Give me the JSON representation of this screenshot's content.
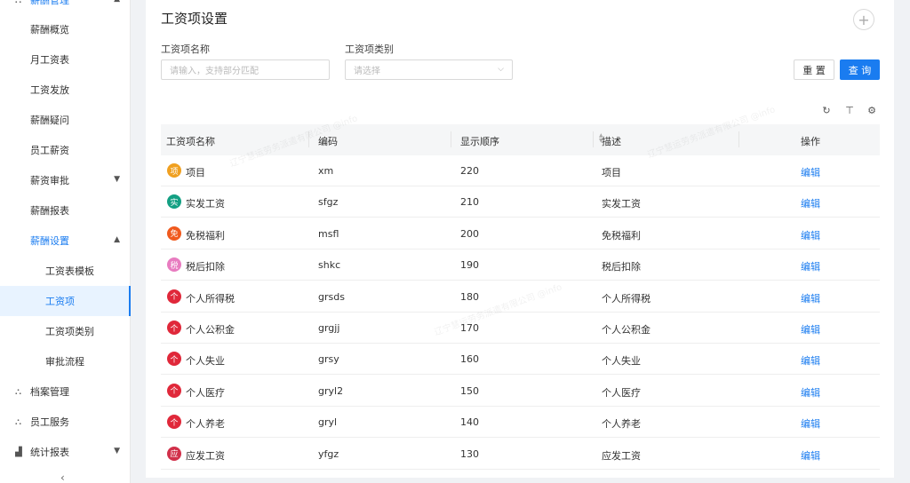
{
  "sidebar": {
    "header_label": "薪酬管理",
    "items": [
      {
        "label": "薪酬概览"
      },
      {
        "label": "月工资表"
      },
      {
        "label": "工资发放"
      },
      {
        "label": "薪酬疑问"
      },
      {
        "label": "员工薪资"
      },
      {
        "label": "薪资审批"
      },
      {
        "label": "薪酬报表"
      },
      {
        "label": "薪酬设置"
      },
      {
        "label": "工资表模板"
      },
      {
        "label": "工资项"
      },
      {
        "label": "工资项类别"
      },
      {
        "label": "审批流程"
      },
      {
        "label": "档案管理"
      },
      {
        "label": "员工服务"
      },
      {
        "label": "统计报表"
      }
    ]
  },
  "main": {
    "title": "工资项设置",
    "filters": {
      "name_label": "工资项名称",
      "name_placeholder": "请输入，支持部分匹配",
      "type_label": "工资项类别",
      "type_placeholder": "请选择"
    },
    "reset_label": "重 置",
    "query_label": "查 询",
    "table": {
      "columns": [
        "工资项名称",
        "编码",
        "显示顺序",
        "描述",
        "操作"
      ],
      "rows": [
        {
          "badge": "项",
          "color": "#f0a020",
          "name": "项目",
          "code": "xm",
          "order": "220",
          "desc": "项目",
          "op": "编辑"
        },
        {
          "badge": "实",
          "color": "#14a083",
          "name": "实发工资",
          "code": "sfgz",
          "order": "210",
          "desc": "实发工资",
          "op": "编辑"
        },
        {
          "badge": "免",
          "color": "#f05a1e",
          "name": "免税福利",
          "code": "msfl",
          "order": "200",
          "desc": "免税福利",
          "op": "编辑"
        },
        {
          "badge": "税",
          "color": "#e87cc0",
          "name": "税后扣除",
          "code": "shkc",
          "order": "190",
          "desc": "税后扣除",
          "op": "编辑"
        },
        {
          "badge": "个",
          "color": "#e0283a",
          "name": "个人所得税",
          "code": "grsds",
          "order": "180",
          "desc": "个人所得税",
          "op": "编辑"
        },
        {
          "badge": "个",
          "color": "#e0283a",
          "name": "个人公积金",
          "code": "grgjj",
          "order": "170",
          "desc": "个人公积金",
          "op": "编辑"
        },
        {
          "badge": "个",
          "color": "#e0283a",
          "name": "个人失业",
          "code": "grsy",
          "order": "160",
          "desc": "个人失业",
          "op": "编辑"
        },
        {
          "badge": "个",
          "color": "#e0283a",
          "name": "个人医疗",
          "code": "gryl2",
          "order": "150",
          "desc": "个人医疗",
          "op": "编辑"
        },
        {
          "badge": "个",
          "color": "#e0283a",
          "name": "个人养老",
          "code": "gryl",
          "order": "140",
          "desc": "个人养老",
          "op": "编辑"
        },
        {
          "badge": "应",
          "color": "#d1304a",
          "name": "应发工资",
          "code": "yfgz",
          "order": "130",
          "desc": "应发工资",
          "op": "编辑"
        }
      ]
    }
  }
}
